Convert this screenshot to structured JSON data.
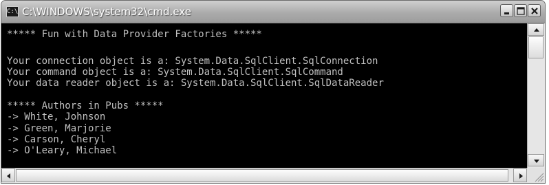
{
  "window": {
    "title": "C:\\WINDOWS\\system32\\cmd.exe",
    "icon_label": "C:\\"
  },
  "console": {
    "lines": [
      "***** Fun with Data Provider Factories *****",
      "",
      "Your connection object is a: System.Data.SqlClient.SqlConnection",
      "Your command object is a: System.Data.SqlClient.SqlCommand",
      "Your data reader object is a: System.Data.SqlClient.SqlDataReader",
      "",
      "***** Authors in Pubs *****",
      "-> White, Johnson",
      "-> Green, Marjorie",
      "-> Carson, Cheryl",
      "-> O'Leary, Michael"
    ]
  },
  "icons": {
    "minimize": "minimize-icon",
    "maximize": "maximize-icon",
    "close": "close-icon"
  },
  "colors": {
    "console_bg": "#000000",
    "console_text": "#c0c0c0"
  }
}
